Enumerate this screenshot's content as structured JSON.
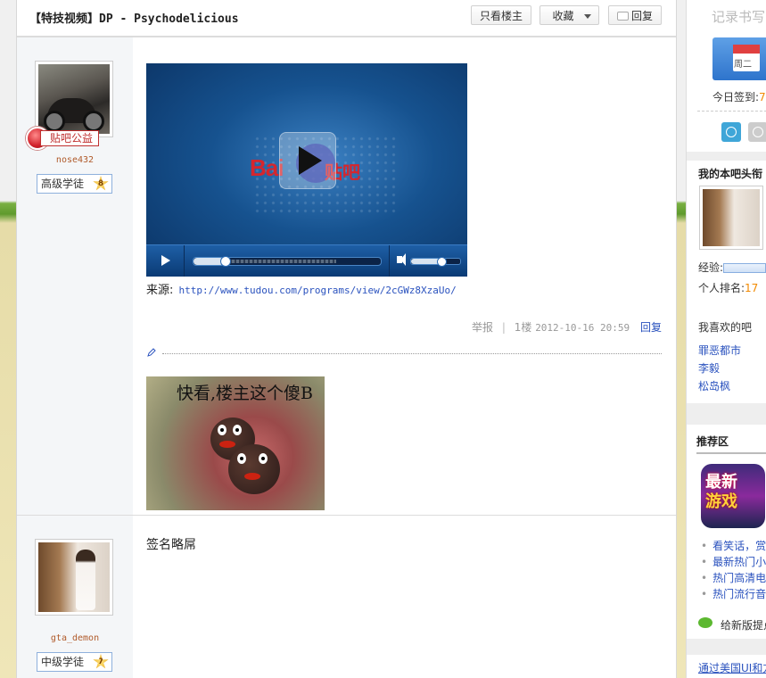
{
  "thread": {
    "title": "【特技视频】DP - Psychodelicious",
    "btn_only_op": "只看楼主",
    "btn_favorite": "收藏",
    "btn_reply": "回复"
  },
  "posts": [
    {
      "user": {
        "name": "nose432",
        "badge": "贴吧公益",
        "level_title": "高级学徒",
        "level_num": "8"
      },
      "video": {
        "progress": 0.16,
        "volume": 0.6,
        "logo": "Bai",
        "logo_cn": "贴吧"
      },
      "source_label": "来源:",
      "source_url": "http://www.tudou.com/programs/view/2cGWz8XzaUo/",
      "meta": {
        "report": "举报",
        "floor": "1楼",
        "time": "2012-10-16 20:59",
        "reply": "回复"
      },
      "meme_caption": "快看,楼主这个傻B"
    },
    {
      "user": {
        "name": "gta_demon",
        "level_title": "中级学徒",
        "level_num": "7"
      },
      "signature": "签名略屌"
    }
  ],
  "sidebar": {
    "handwriting": "记录书写",
    "calendar_day": "周二",
    "signed_today_label": "今日签到:",
    "signed_today_value": "7",
    "my_title_heading": "我的本吧头衔",
    "exp_label": "经验:",
    "rank_label": "个人排名:",
    "rank_value": "17",
    "liked_heading": "我喜欢的吧",
    "liked_bars": [
      "罪恶都市",
      "李毅",
      "松岛枫"
    ],
    "recommend_heading": "推荐区",
    "game_line1": "最新",
    "game_line2": "游戏",
    "recommend_links": [
      "看笑话，赏",
      "最新热门小",
      "热门高清电",
      "热门流行音"
    ],
    "suggest": "给新版提点",
    "bottom_link": "通过美国UI和方"
  }
}
